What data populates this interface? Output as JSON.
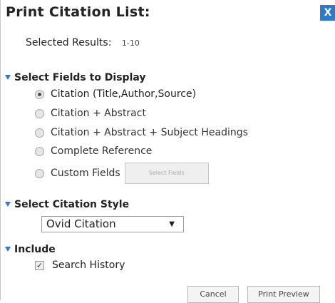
{
  "dialog": {
    "title": "Print Citation List:",
    "close_label": "X"
  },
  "selected_results": {
    "label": "Selected Results:",
    "value": "1-10"
  },
  "fields_section": {
    "heading": "Select Fields to Display",
    "options": [
      {
        "label": "Citation (Title,Author,Source)",
        "selected": true
      },
      {
        "label": "Citation + Abstract",
        "selected": false
      },
      {
        "label": "Citation + Abstract + Subject Headings",
        "selected": false
      },
      {
        "label": "Complete Reference",
        "selected": false
      },
      {
        "label": "Custom Fields",
        "selected": false
      }
    ],
    "select_fields_button": "Select Fields"
  },
  "style_section": {
    "heading": "Select Citation Style",
    "selected_style": "Ovid Citation"
  },
  "include_section": {
    "heading": "Include",
    "search_history_label": "Search History",
    "search_history_checked": true
  },
  "actions": {
    "cancel_label": "Cancel",
    "print_preview_label": "Print Preview"
  }
}
